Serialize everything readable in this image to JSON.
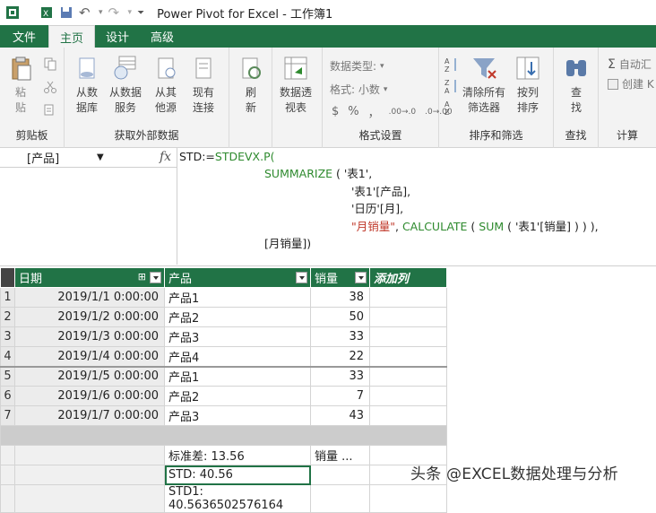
{
  "window": {
    "title": "Power Pivot for Excel - 工作簿1"
  },
  "tabs": [
    {
      "label": "文件"
    },
    {
      "label": "主页"
    },
    {
      "label": "设计"
    },
    {
      "label": "高级"
    }
  ],
  "ribbon": {
    "clipboard": {
      "paste": "粘\n贴",
      "group": "剪贴板"
    },
    "external": {
      "db": "从数\n据库",
      "service": "从数据\n服务",
      "other": "从其\n他源",
      "existing": "现有\n连接",
      "group": "获取外部数据"
    },
    "refresh": {
      "label": "刷\n新"
    },
    "pivot": {
      "label": "数据透\n视表"
    },
    "format": {
      "datatype": "数据类型:",
      "fmt": "格式: 小数",
      "symbols": [
        "$",
        "%",
        "，",
        ".00→.0",
        ".0→.00"
      ],
      "group": "格式设置"
    },
    "sort": {
      "clear": "清除所有\n筛选器",
      "bycol": "按列\n排序",
      "group": "排序和筛选"
    },
    "find": {
      "label": "查\n找",
      "group": "查找"
    },
    "calc": {
      "autosum": "自动汇",
      "create": "创建 K",
      "group": "计算"
    }
  },
  "namebox": {
    "value": "[产品]"
  },
  "formula": {
    "line1_a": "STD:=",
    "line1_b": "STDEVX.P(",
    "line2_a": "SUMMARIZE",
    "line2_b": " ( '表1',",
    "line3": "'表1'[产品],",
    "line4": "'日历'[月],",
    "line5_a": "\"月销量\"",
    "line5_b": ", ",
    "line5_c": "CALCULATE",
    "line5_d": " ( ",
    "line5_e": "SUM",
    "line5_f": " ( '表1'[销量] ) ) ),",
    "line6": "[月销量])"
  },
  "grid": {
    "headers": {
      "date": "日期",
      "product": "产品",
      "qty": "销量",
      "add": "添加列"
    },
    "rows": [
      {
        "n": "1",
        "date": "2019/1/1 0:00:00",
        "product": "产品1",
        "qty": "38"
      },
      {
        "n": "2",
        "date": "2019/1/2 0:00:00",
        "product": "产品2",
        "qty": "50"
      },
      {
        "n": "3",
        "date": "2019/1/3 0:00:00",
        "product": "产品3",
        "qty": "33"
      },
      {
        "n": "4",
        "date": "2019/1/4 0:00:00",
        "product": "产品4",
        "qty": "22"
      },
      {
        "n": "5",
        "date": "2019/1/5 0:00:00",
        "product": "产品1",
        "qty": "33"
      },
      {
        "n": "6",
        "date": "2019/1/6 0:00:00",
        "product": "产品2",
        "qty": "7"
      },
      {
        "n": "7",
        "date": "2019/1/7 0:00:00",
        "product": "产品3",
        "qty": "43"
      }
    ],
    "calc": {
      "std_dev": "标准差: 13.56",
      "qty_measure": "销量 ...",
      "std": "STD: 40.56",
      "std1": "STD1: 40.5636502576164"
    }
  },
  "watermark": "头条 @EXCEL数据处理与分析",
  "colors": {
    "accent": "#217346",
    "function": "#2e8a2e",
    "string": "#c0392b"
  }
}
